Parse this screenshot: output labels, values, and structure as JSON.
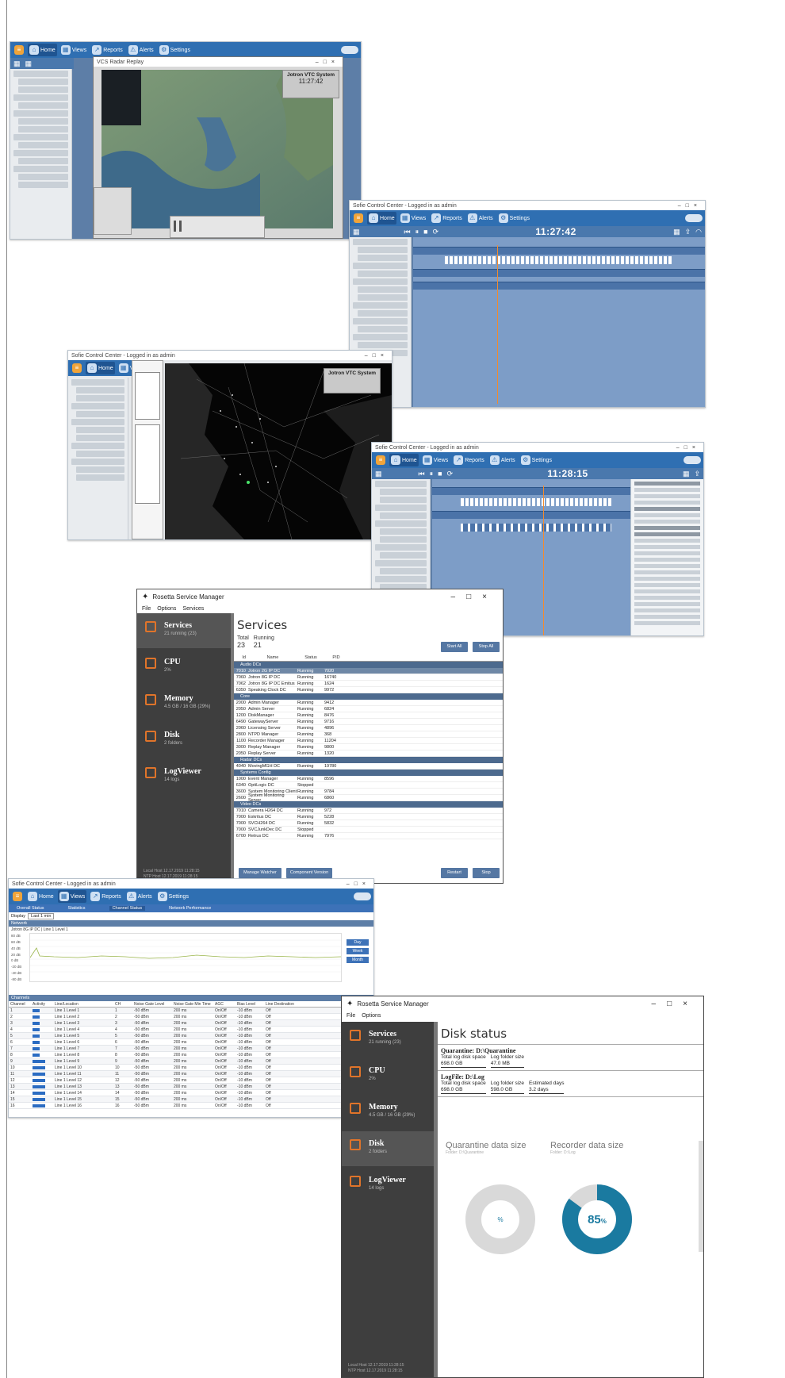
{
  "dispatch_app": {
    "menu": [
      "Home",
      "Views",
      "Reports",
      "Alerts",
      "Settings"
    ]
  },
  "map_shot_1": {
    "window_title": "VCS Radar Replay",
    "overlay_title": "Jotron VTC System",
    "overlay_time": "11:27:42"
  },
  "timeline_shot_1": {
    "window_title": "Sofie Control Center - Logged in as admin",
    "clock": "11:27:42"
  },
  "map_shot_2": {
    "window_title": "Sofie Control Center - Logged in as admin",
    "overlay_title": "Jotron VTC System"
  },
  "timeline_shot_2": {
    "window_title": "Sofie Control Center - Logged in as admin",
    "clock": "11:28:15"
  },
  "service_manager": {
    "window_title": "Rosetta Service Manager",
    "menu": [
      "File",
      "Options",
      "Services"
    ],
    "nav": [
      {
        "title": "Services",
        "sub": "21 running (23)"
      },
      {
        "title": "CPU",
        "sub": "2%"
      },
      {
        "title": "Memory",
        "sub": "4.5 GB / 16 GB (29%)"
      },
      {
        "title": "Disk",
        "sub": "2 folders"
      },
      {
        "title": "LogViewer",
        "sub": "14 logs"
      }
    ],
    "footer": [
      "Local Host  12.17.2019 11:28:15",
      "NTP Host  12.17.2019 11:28:15"
    ],
    "heading": "Services",
    "total_label": "Total",
    "total_value": "23",
    "running_label": "Running",
    "running_value": "21",
    "btn_start_all": "Start All",
    "btn_stop_all": "Stop All",
    "columns": [
      "Id",
      "Name",
      "Status",
      "PID"
    ],
    "groups": [
      {
        "name": "Audio DCs",
        "rows": [
          {
            "id": "7010",
            "name": "Jotron 2G IP DC",
            "status": "Running",
            "pid": "7020",
            "sel": true
          },
          {
            "id": "7060",
            "name": "Jotron 8G IP DC",
            "status": "Running",
            "pid": "16740"
          },
          {
            "id": "7062",
            "name": "Jotron 8G IP DC Emitus",
            "status": "Running",
            "pid": "1624"
          },
          {
            "id": "6350",
            "name": "Speaking Clock DC",
            "status": "Running",
            "pid": "9972"
          }
        ]
      },
      {
        "name": "Core",
        "rows": [
          {
            "id": "2000",
            "name": "Admin Manager",
            "status": "Running",
            "pid": "9412"
          },
          {
            "id": "2050",
            "name": "Admin Server",
            "status": "Running",
            "pid": "6824"
          },
          {
            "id": "1200",
            "name": "DiskManager",
            "status": "Running",
            "pid": "8476"
          },
          {
            "id": "6490",
            "name": "GatewayServer",
            "status": "Running",
            "pid": "9716"
          },
          {
            "id": "2060",
            "name": "Licensing Server",
            "status": "Running",
            "pid": "4896"
          },
          {
            "id": "2800",
            "name": "NTPD Manager",
            "status": "Running",
            "pid": "368"
          },
          {
            "id": "1100",
            "name": "Recorder Manager",
            "status": "Running",
            "pid": "11204"
          },
          {
            "id": "3000",
            "name": "Replay Manager",
            "status": "Running",
            "pid": "9800"
          },
          {
            "id": "2050",
            "name": "Replay Server",
            "status": "Running",
            "pid": "1320"
          }
        ]
      },
      {
        "name": "Radar DCs",
        "rows": [
          {
            "id": "4040",
            "name": "MovingMGH DC",
            "status": "Running",
            "pid": "19780"
          }
        ]
      },
      {
        "name": "Systems Config",
        "rows": [
          {
            "id": "1000",
            "name": "Event Manager",
            "status": "Running",
            "pid": "8596"
          },
          {
            "id": "6340",
            "name": "OptiLogic DC",
            "status": "Stopped",
            "pid": ""
          },
          {
            "id": "3600",
            "name": "System Monitoring Client",
            "status": "Running",
            "pid": "9784"
          },
          {
            "id": "2600",
            "name": "System Monitoring Server",
            "status": "Running",
            "pid": "6860"
          }
        ]
      },
      {
        "name": "Video DCs",
        "rows": [
          {
            "id": "7010",
            "name": "Camera H264 DC",
            "status": "Running",
            "pid": "972"
          },
          {
            "id": "7000",
            "name": "Eskritus DC",
            "status": "Running",
            "pid": "5228"
          },
          {
            "id": "7000",
            "name": "SVCH264 DC",
            "status": "Running",
            "pid": "5832"
          },
          {
            "id": "7000",
            "name": "SVCJunkDec DC",
            "status": "Stopped",
            "pid": ""
          },
          {
            "id": "6700",
            "name": "Retrus DC",
            "status": "Running",
            "pid": "7976"
          }
        ]
      }
    ],
    "btn_manage": "Manage Watcher",
    "btn_component": "Component Version",
    "btn_restart": "Restart",
    "btn_stop": "Stop"
  },
  "stats_shot": {
    "window_title": "Sofie Control Center - Logged in as admin",
    "tabs": [
      "Overall Status",
      "Statistics",
      "Channel Status",
      "Network Performance"
    ],
    "filter_label": "Display",
    "filter_value": "Last 1 min",
    "chart_title": "Network",
    "chart_subtitle": "Jotron 8G IP DC | Line 1 Level 1",
    "y_ticks": [
      "-80 dB",
      "-40 dB",
      "-20 dB",
      "0 dB",
      "20 dB",
      "40 dB",
      "60 dB",
      "80 dB"
    ],
    "side_buttons": [
      "Day",
      "Week",
      "Month"
    ],
    "table_title": "Channels",
    "columns": [
      "Channel",
      "Activity",
      "Line/Location",
      "CH",
      "Noise Gate Level",
      "Noise Gate Min Time",
      "AGC",
      "Bias Level",
      "Line Destination"
    ],
    "rows": [
      {
        "ch": "1",
        "name": "Line 1 Level 1",
        "w": 0.45
      },
      {
        "ch": "2",
        "name": "Line 1 Level 2",
        "w": 0.45
      },
      {
        "ch": "3",
        "name": "Line 1 Level 3",
        "w": 0.45
      },
      {
        "ch": "4",
        "name": "Line 1 Level 4",
        "w": 0.45
      },
      {
        "ch": "5",
        "name": "Line 1 Level 5",
        "w": 0.45
      },
      {
        "ch": "6",
        "name": "Line 1 Level 6",
        "w": 0.45
      },
      {
        "ch": "7",
        "name": "Line 1 Level 7",
        "w": 0.45
      },
      {
        "ch": "8",
        "name": "Line 1 Level 8",
        "w": 0.45
      },
      {
        "ch": "9",
        "name": "Line 1 Level 9",
        "w": 0.8
      },
      {
        "ch": "10",
        "name": "Line 1 Level 10",
        "w": 0.8
      },
      {
        "ch": "11",
        "name": "Line 1 Level 11",
        "w": 0.8
      },
      {
        "ch": "12",
        "name": "Line 1 Level 12",
        "w": 0.8
      },
      {
        "ch": "13",
        "name": "Line 1 Level 13",
        "w": 0.8
      },
      {
        "ch": "14",
        "name": "Line 1 Level 14",
        "w": 0.8
      },
      {
        "ch": "15",
        "name": "Line 1 Level 15",
        "w": 0.8
      },
      {
        "ch": "16",
        "name": "Line 1 Level 16",
        "w": 0.8
      }
    ],
    "cell_ngl": "-50 dBm",
    "cell_ngt": "200 ms",
    "cell_agc": "On/Off",
    "cell_bias": "-10 dBm",
    "cell_dest": "Off"
  },
  "disk_manager": {
    "window_title": "Rosetta Service Manager",
    "menu": [
      "File",
      "Options"
    ],
    "nav": [
      {
        "title": "Services",
        "sub": "21 running (23)"
      },
      {
        "title": "CPU",
        "sub": "2%"
      },
      {
        "title": "Memory",
        "sub": "4.5 GB / 16 GB (29%)"
      },
      {
        "title": "Disk",
        "sub": "2 folders"
      },
      {
        "title": "LogViewer",
        "sub": "14 logs"
      }
    ],
    "heading": "Disk status",
    "quarantine_title": "Quarantine: D:\\Quarantine",
    "q_label_total": "Total log disk space",
    "q_val_total": "698.0 GB",
    "q_label_folder": "Log folder size",
    "q_val_folder": "47.0 MB",
    "log_title": "LogFile: D:\\Log",
    "l_label_total": "Total log disk space",
    "l_val_total": "698.0 GB",
    "l_label_folder": "Log folder size",
    "l_val_folder": "598.0 GB",
    "l_label_days": "Estimated days",
    "l_val_days": "3.2 days",
    "chart1_title": "Quarantine data size",
    "chart1_sub": "Folder: D:\\Quarantine",
    "chart1_value": "%",
    "chart2_title": "Recorder data size",
    "chart2_sub": "Folder: D:\\Log",
    "chart2_value": "85",
    "chart2_unit": "%",
    "chart2_fraction": 0.85,
    "accent": "#1a7aa0",
    "footer": [
      "Local Host  12.17.2019 11:28:15",
      "NTP Host  12.17.2019 11:28:15"
    ]
  }
}
